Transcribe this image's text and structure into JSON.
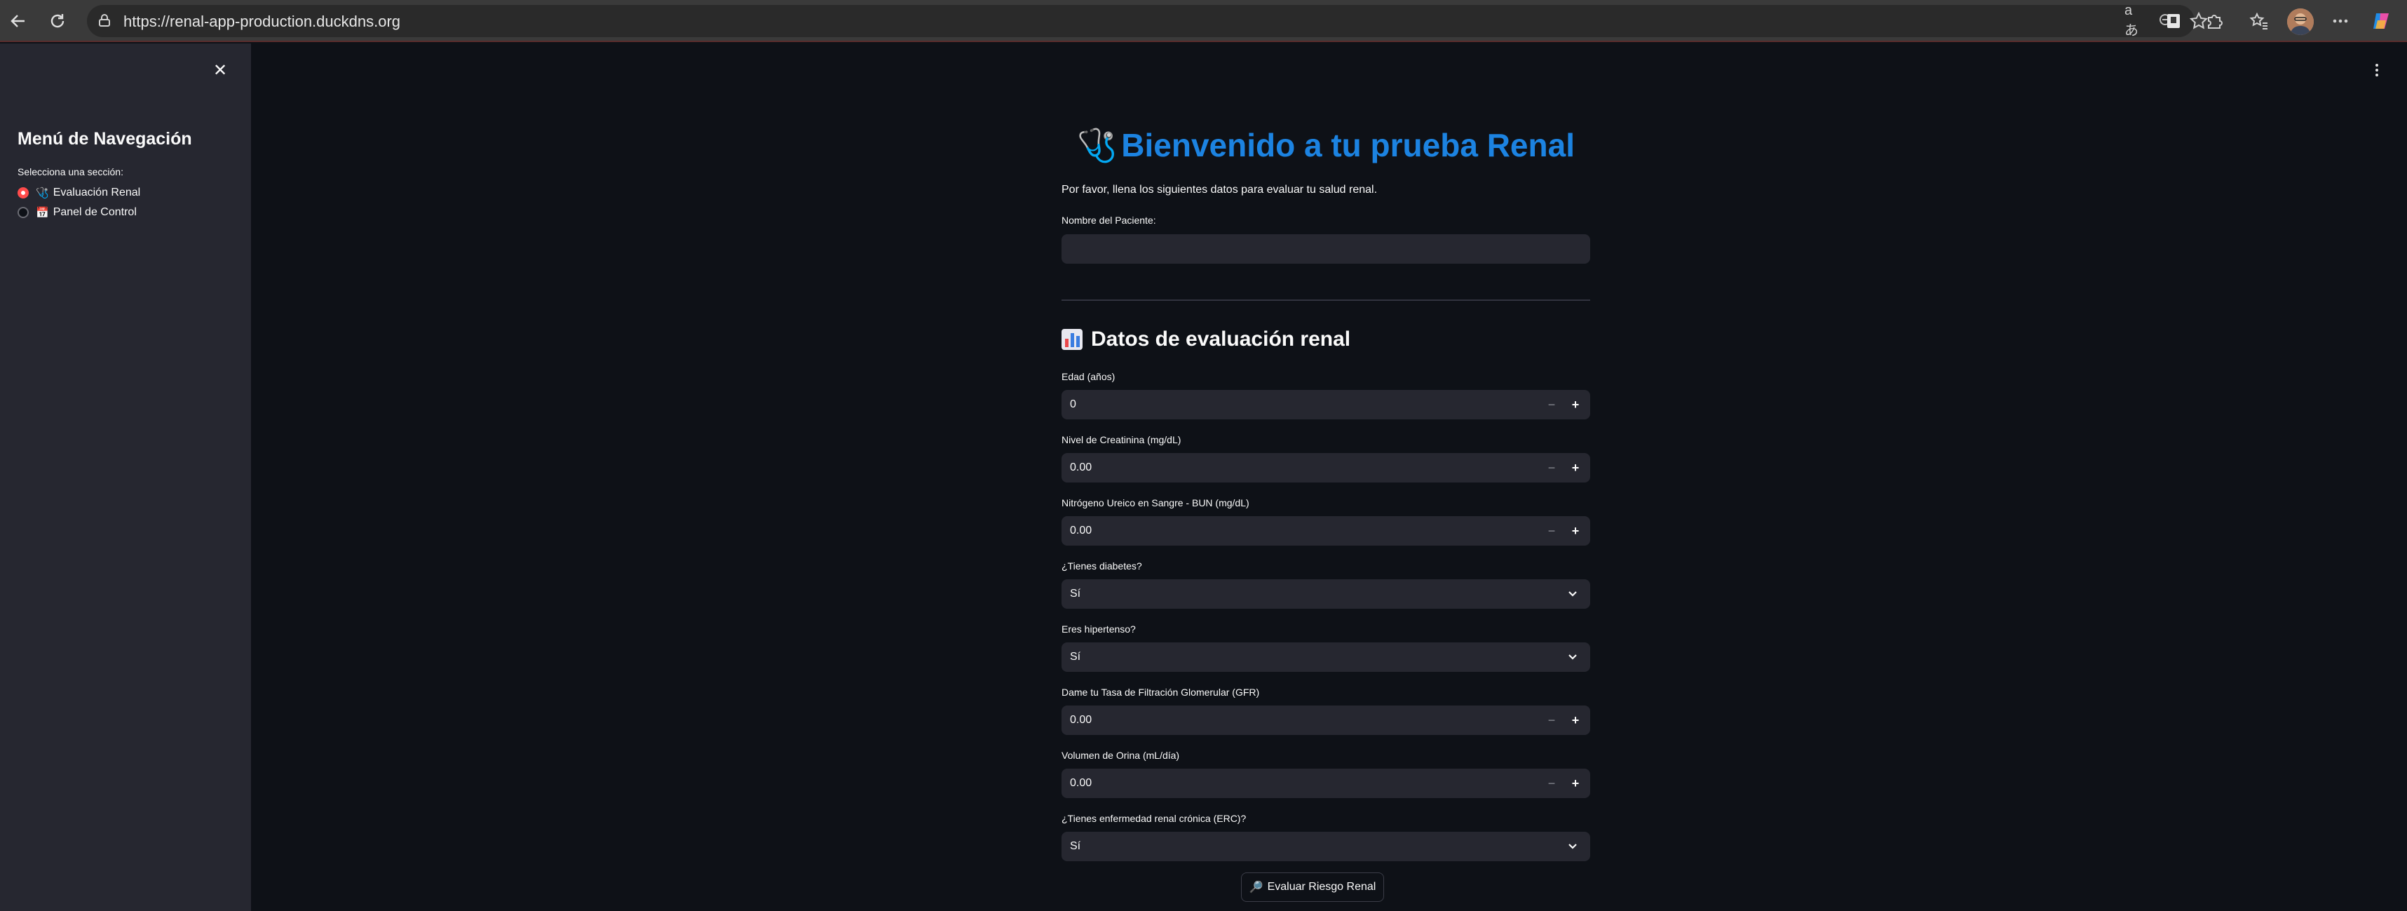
{
  "browser": {
    "url": "https://renal-app-production.duckdns.org",
    "read_aloud_icon": "aあ"
  },
  "sidebar": {
    "title": "Menú de Navegación",
    "section_label": "Selecciona una sección:",
    "options": [
      {
        "emoji": "🩺",
        "label": "Evaluación Renal",
        "selected": true
      },
      {
        "emoji": "📅",
        "label": "Panel de Control",
        "selected": false
      }
    ]
  },
  "main": {
    "title_emoji": "🩺",
    "title": "Bienvenido a tu prueba Renal",
    "intro": "Por favor, llena los siguientes datos para evaluar tu salud renal.",
    "patient_label": "Nombre del Paciente:",
    "patient_value": "",
    "section_title": "Datos de evaluación renal",
    "fields": [
      {
        "label": "Edad (años)",
        "type": "number",
        "value": "0"
      },
      {
        "label": "Nivel de Creatinina (mg/dL)",
        "type": "number",
        "value": "0.00"
      },
      {
        "label": "Nitrógeno Ureico en Sangre - BUN (mg/dL)",
        "type": "number",
        "value": "0.00"
      },
      {
        "label": "¿Tienes diabetes?",
        "type": "select",
        "value": "Sí"
      },
      {
        "label": "Eres hipertenso?",
        "type": "select",
        "value": "Sí"
      },
      {
        "label": "Dame tu Tasa de Filtración Glomerular (GFR)",
        "type": "number",
        "value": "0.00"
      },
      {
        "label": "Volumen de Orina (mL/día)",
        "type": "number",
        "value": "0.00"
      },
      {
        "label": "¿Tienes enfermedad renal crónica (ERC)?",
        "type": "select",
        "value": "Sí"
      }
    ],
    "button_label": "Evaluar Riesgo Renal",
    "button_emoji": "🔎",
    "stepper_minus": "−",
    "stepper_plus": "+"
  },
  "colors": {
    "accent": "#ff4b4b",
    "title_blue": "#1c83e1",
    "background": "#0e1117",
    "sidebar": "#262730",
    "input": "#262730"
  }
}
